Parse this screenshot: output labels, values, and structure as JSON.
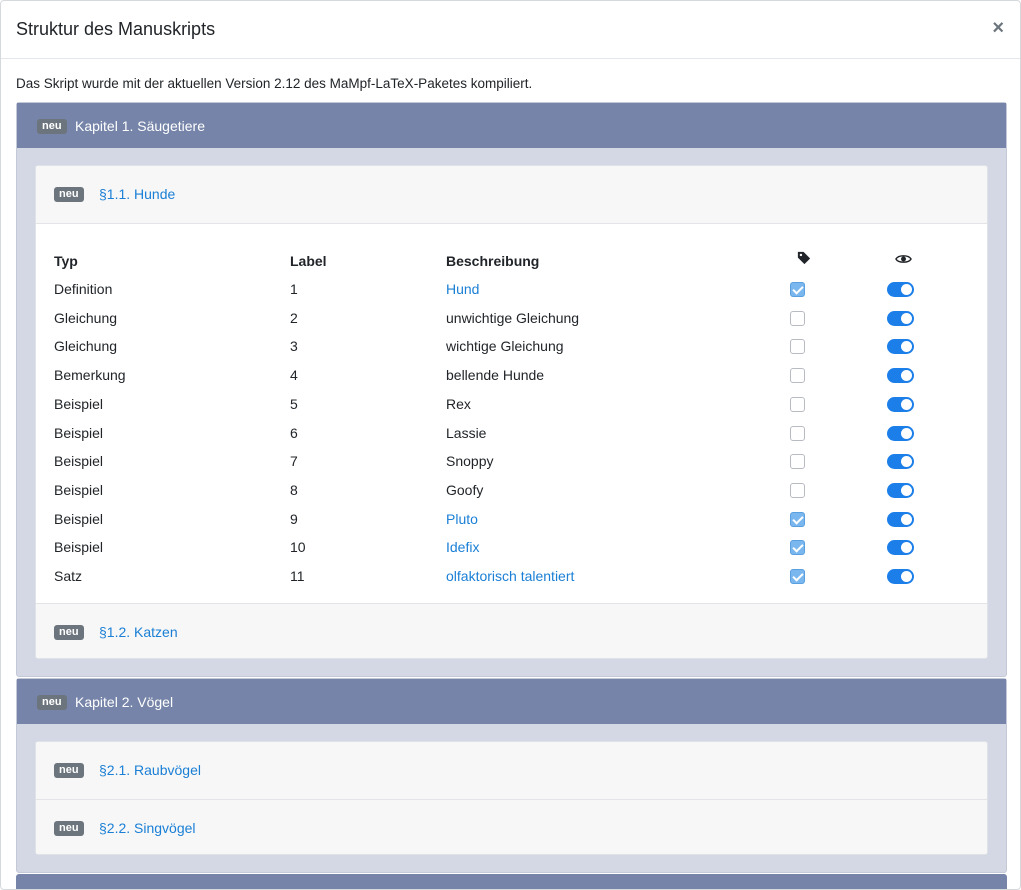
{
  "modal": {
    "title": "Struktur des Manuskripts",
    "close_label": "×",
    "intro": "Das Skript wurde mit der aktuellen Version 2.12 des MaMpf-LaTeX-Paketes kompiliert."
  },
  "badge_label": "neu",
  "chapters": [
    {
      "title": "Kapitel 1. Säugetiere",
      "sections": [
        {
          "title": "§1.1. Hunde"
        },
        {
          "title": "§1.2. Katzen"
        }
      ]
    },
    {
      "title": "Kapitel 2. Vögel",
      "sections": [
        {
          "title": "§2.1. Raubvögel"
        },
        {
          "title": "§2.2. Singvögel"
        }
      ]
    }
  ],
  "table": {
    "headers": {
      "type": "Typ",
      "label": "Label",
      "description": "Beschreibung",
      "tag_icon": "tag-icon",
      "visibility_icon": "eye-icon"
    },
    "rows": [
      {
        "type": "Definition",
        "label": "1",
        "description": "Hund",
        "tagged": true,
        "visible": true
      },
      {
        "type": "Gleichung",
        "label": "2",
        "description": "unwichtige Gleichung",
        "tagged": false,
        "visible": true
      },
      {
        "type": "Gleichung",
        "label": "3",
        "description": "wichtige Gleichung",
        "tagged": false,
        "visible": true
      },
      {
        "type": "Bemerkung",
        "label": "4",
        "description": "bellende Hunde",
        "tagged": false,
        "visible": true
      },
      {
        "type": "Beispiel",
        "label": "5",
        "description": "Rex",
        "tagged": false,
        "visible": true
      },
      {
        "type": "Beispiel",
        "label": "6",
        "description": "Lassie",
        "tagged": false,
        "visible": true
      },
      {
        "type": "Beispiel",
        "label": "7",
        "description": "Snoppy",
        "tagged": false,
        "visible": true
      },
      {
        "type": "Beispiel",
        "label": "8",
        "description": "Goofy",
        "tagged": false,
        "visible": true
      },
      {
        "type": "Beispiel",
        "label": "9",
        "description": "Pluto",
        "tagged": true,
        "visible": true
      },
      {
        "type": "Beispiel",
        "label": "10",
        "description": "Idefix",
        "tagged": true,
        "visible": true
      },
      {
        "type": "Satz",
        "label": "11",
        "description": "olfaktorisch talentiert",
        "tagged": true,
        "visible": true
      }
    ]
  },
  "colors": {
    "chapter_header": "#7584a8",
    "chapter_body": "#d3d8e4",
    "link": "#1a7fd5",
    "toggle_on": "#1c7fe9",
    "badge": "#6c757d"
  }
}
